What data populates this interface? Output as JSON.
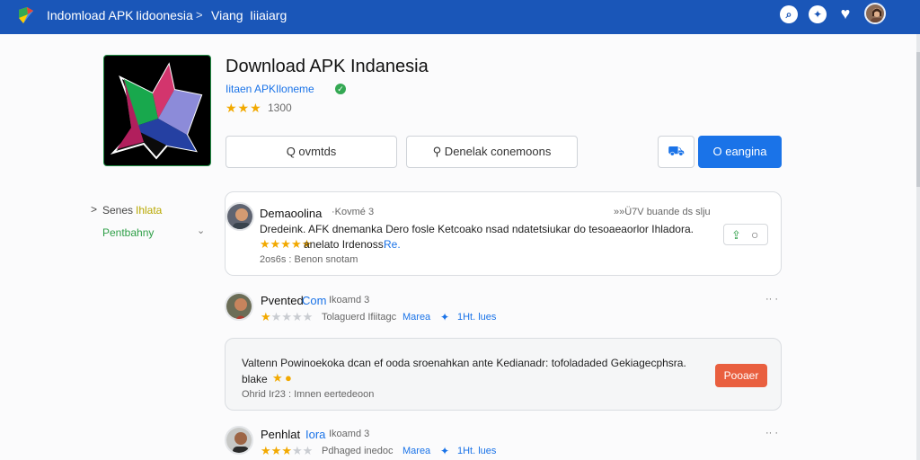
{
  "topbar": {
    "crumb1": "Indomload APK",
    "crumb2": "Iidoonesia",
    "separator": ">",
    "crumb3": "Viang",
    "crumb4": "Iiiaiarg",
    "icons": [
      "search-icon",
      "tools-icon",
      "heart-icon"
    ]
  },
  "app": {
    "title": "Download APK Indanesia",
    "subtitle": "Iitaen APKIloneme",
    "stars": "★★★",
    "rating_count": "1300"
  },
  "buttons": {
    "search_label": "Q ovmtds",
    "download_label": "⚲ Denelak conemoons",
    "icon_button": "⛟",
    "primary_label": "O eangina"
  },
  "sidebar": {
    "item1_prefix": ">",
    "item1_label": "Senes",
    "item1_highlight": "Ihlata",
    "item2_label": "Pentbahny",
    "item2_icon": "chevron-down-icon"
  },
  "reviews": [
    {
      "author": "Demaoolina",
      "meta": "·Kovmé 3",
      "right_meta": "»»Ü7V buande ds slju",
      "body1": "Dredeink. AFK dnemanka Dero fosle Ketcoako nsad ndatetsiukar do tesoaeaorlor Ihladora.",
      "stars": "★★★★★",
      "body2": "anelato Irdenoss:",
      "body2_blue": "Re.",
      "date": "2os6s : Benon snotam"
    },
    {
      "author": "Pvented",
      "author_blue": "Com",
      "meta": "Ikoamd 3",
      "filled": 1,
      "total": 5,
      "stars": "★★★★★",
      "text": "Tolaguerd Ifiitagc",
      "blue1": "Marea",
      "blue2": "1Ht. lues",
      "right_meta": "·· ·"
    },
    {
      "body1": "Valtenn Powinoekoka dcan ef ooda sroenahkan ante Kedianadr: tofoladaded Gekiagecphsra.",
      "body2": "blake",
      "date": "Ohrid Ir23 : Imnen eertedeoon",
      "report_label": "Pooaer"
    },
    {
      "author": "Penhlat",
      "author_blue": "Iora",
      "meta": "Ikoamd 3",
      "filled": 3,
      "total": 5,
      "stars": "★★★★★",
      "text": "Pdhaged inedoc",
      "blue1": "Marea",
      "blue2": "1Ht. lues",
      "right_meta": "·· ·"
    }
  ],
  "colors": {
    "topbar": "#1a56b8",
    "accent": "#1a73e8",
    "green": "#2e9f47",
    "star": "#f2a900",
    "report": "#e95f3f"
  }
}
